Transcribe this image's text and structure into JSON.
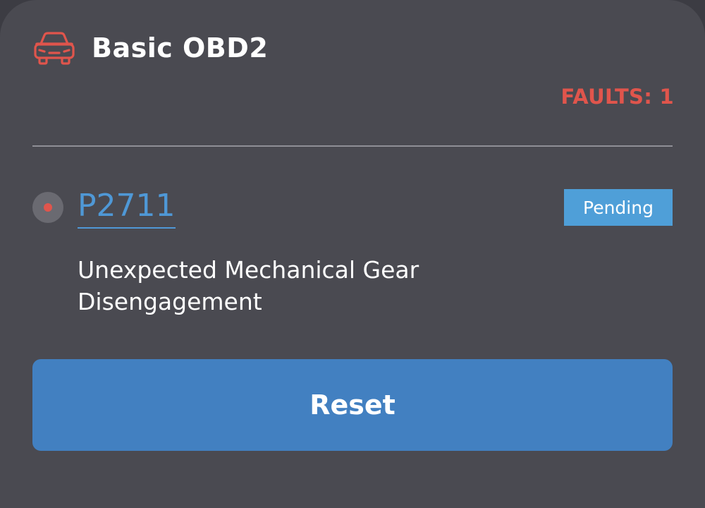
{
  "header": {
    "title": "Basic OBD2",
    "icon": "car-icon"
  },
  "summary": {
    "faults_label": "FAULTS: 1"
  },
  "fault": {
    "code": "P2711",
    "status": "Pending",
    "description": "Unexpected Mechanical Gear Disengagement"
  },
  "actions": {
    "reset_label": "Reset"
  },
  "colors": {
    "background": "#4a4a51",
    "accent_red": "#e0554c",
    "link_blue": "#4f98d6",
    "badge_blue": "#4f9fd8",
    "button_blue": "#4280c1"
  }
}
